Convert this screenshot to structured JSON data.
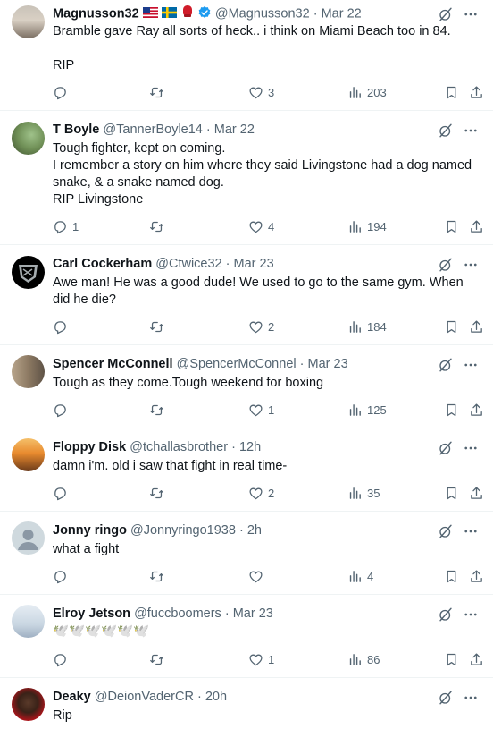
{
  "tweets": [
    {
      "name": "Magnusson32",
      "handle": "@Magnusson32",
      "sep": "·",
      "time": "Mar 22",
      "text": "Bramble gave Ray all sorts of heck.. i think on Miami Beach too in 84.\n\nRIP",
      "replies": "",
      "retweets": "",
      "likes": "3",
      "views": "203"
    },
    {
      "name": "T Boyle",
      "handle": "@TannerBoyle14",
      "sep": "·",
      "time": "Mar 22",
      "text": "Tough fighter, kept on coming.\nI remember a story on him where they said Livingstone had a dog named snake, & a snake named dog.\nRIP Livingstone",
      "replies": "1",
      "retweets": "",
      "likes": "4",
      "views": "194"
    },
    {
      "name": "Carl Cockerham",
      "handle": "@Ctwice32",
      "sep": "·",
      "time": "Mar 23",
      "text": "Awe man! He was a good dude! We used to go to the same gym. When did he die?",
      "replies": "",
      "retweets": "",
      "likes": "2",
      "views": "184"
    },
    {
      "name": "Spencer McConnell",
      "handle": "@SpencerMcConnel",
      "sep": "·",
      "time": "Mar 23",
      "text": "Tough as they come.Tough weekend for boxing",
      "replies": "",
      "retweets": "",
      "likes": "1",
      "views": "125"
    },
    {
      "name": "Floppy Disk",
      "handle": "@tchallasbrother",
      "sep": "·",
      "time": "12h",
      "text": "damn i'm. old i saw that fight in real time-",
      "replies": "",
      "retweets": "",
      "likes": "2",
      "views": "35"
    },
    {
      "name": "Jonny ringo",
      "handle": "@Jonnyringo1938",
      "sep": "·",
      "time": "2h",
      "text": "what a fight",
      "replies": "",
      "retweets": "",
      "likes": "",
      "views": "4"
    },
    {
      "name": "Elroy Jetson",
      "handle": "@fuccboomers",
      "sep": "·",
      "time": "Mar 23",
      "text": "🕊️🕊️🕊️🕊️🕊️🕊️",
      "replies": "",
      "retweets": "",
      "likes": "1",
      "views": "86"
    },
    {
      "name": "Deaky",
      "handle": "@DeionVaderCR",
      "sep": "·",
      "time": "20h",
      "text": "Rip",
      "replies": "",
      "retweets": "",
      "likes": "",
      "views": ""
    }
  ],
  "colors": {
    "text": "#0f1419",
    "muted": "#536471",
    "verified": "#1d9bf0",
    "divider": "#eff3f4"
  },
  "icons": [
    "reply-icon",
    "retweet-icon",
    "like-icon",
    "views-icon",
    "bookmark-icon",
    "share-icon",
    "grok-icon",
    "more-icon",
    "verified-icon"
  ]
}
